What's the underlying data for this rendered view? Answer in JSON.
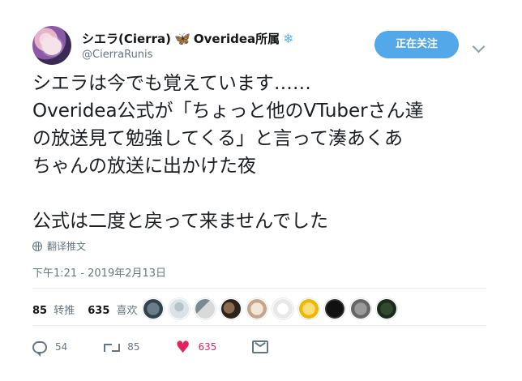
{
  "header": {
    "display_name": "シエラ(Cierra)",
    "name_suffix": "Overidea所属",
    "handle": "@CierraRunis",
    "follow_button_label": "正在关注"
  },
  "tweet": {
    "text": "シエラは今でも覚えています……\nOveridea公式が「ちょっと他のVTuberさん達\nの放送見て勉強してくる」と言って湊あくあ\nちゃんの放送に出かけた夜\n\n公式は二度と戻って来ませんでした",
    "translate_label": "翻译推文",
    "timestamp": "下午1:21 - 2019年2月13日"
  },
  "stats": {
    "retweets": "85",
    "retweets_label": "转推",
    "likes": "635",
    "likes_label": "喜欢"
  },
  "actions": {
    "reply_count": "54",
    "retweet_count": "85",
    "like_count": "635"
  },
  "icons": [
    "butterfly-icon",
    "snowflake-icon",
    "globe-icon",
    "reply-icon",
    "retweet-icon",
    "heart-icon",
    "mail-icon",
    "chevron-down-icon"
  ],
  "colors": {
    "accent": "#52a8e8",
    "like": "#e0245e",
    "secondary_text": "#657786"
  }
}
